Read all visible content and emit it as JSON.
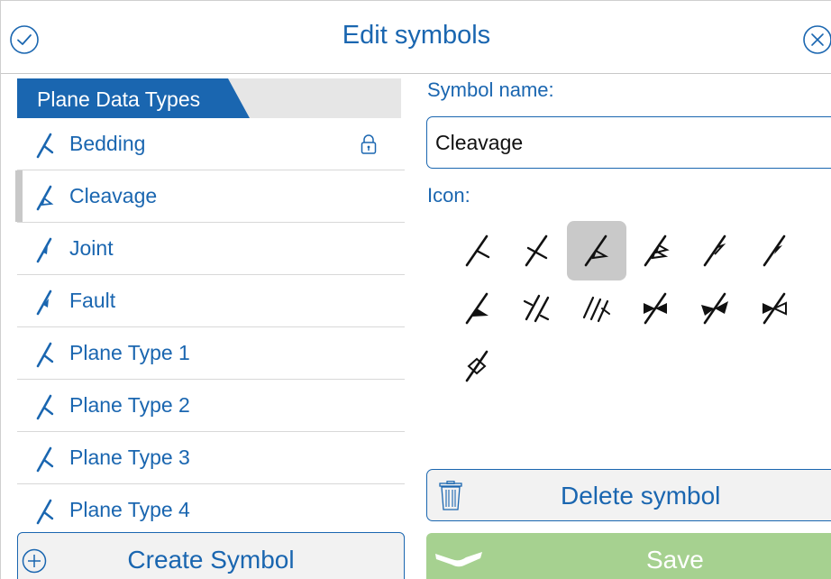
{
  "header": {
    "title": "Edit symbols",
    "done_icon": "checkmark-circle-icon",
    "close_icon": "close-circle-icon"
  },
  "colors": {
    "accent": "#1a66b0",
    "tab_bg": "#1a66b0",
    "selected_row": "#c8c8c8",
    "save_disabled": "#a6d190",
    "divider": "#d8d8d8"
  },
  "sidebar": {
    "tab_label": "Plane Data Types",
    "items": [
      {
        "label": "Bedding",
        "icon": "bedding-strike-dip-icon",
        "locked": true
      },
      {
        "label": "Cleavage",
        "icon": "cleavage-strike-dip-icon",
        "selected": true
      },
      {
        "label": "Joint",
        "icon": "joint-strike-dip-icon"
      },
      {
        "label": "Fault",
        "icon": "fault-strike-dip-icon"
      },
      {
        "label": "Plane Type 1",
        "icon": "plane-strike-dip-icon"
      },
      {
        "label": "Plane Type 2",
        "icon": "plane-strike-dip-icon"
      },
      {
        "label": "Plane Type 3",
        "icon": "plane-strike-dip-icon"
      },
      {
        "label": "Plane Type 4",
        "icon": "plane-strike-dip-icon"
      }
    ],
    "create_label": "Create Symbol",
    "create_icon": "plus-circle-icon"
  },
  "editor": {
    "name_label": "Symbol name:",
    "name_value": "Cleavage",
    "name_placeholder": "",
    "icon_label": "Icon:",
    "selected_icon_index": 2,
    "icon_options": [
      "plain-strike-dip-icon",
      "crossed-strike-dip-icon",
      "open-triangle-strike-dip-icon",
      "double-triangle-strike-dip-icon",
      "half-triangle-strike-dip-icon",
      "filled-half-triangle-strike-dip-icon",
      "filled-triangle-strike-dip-icon",
      "double-slash-strike-dip-icon",
      "triple-slash-strike-dip-icon",
      "bowtie-strike-dip-icon",
      "filled-bowtie-strike-dip-icon",
      "open-bowtie-strike-dip-icon",
      "diamond-strike-dip-icon"
    ],
    "delete_label": "Delete symbol",
    "delete_icon": "trash-icon",
    "save_label": "Save",
    "save_icon": "save-icon"
  }
}
